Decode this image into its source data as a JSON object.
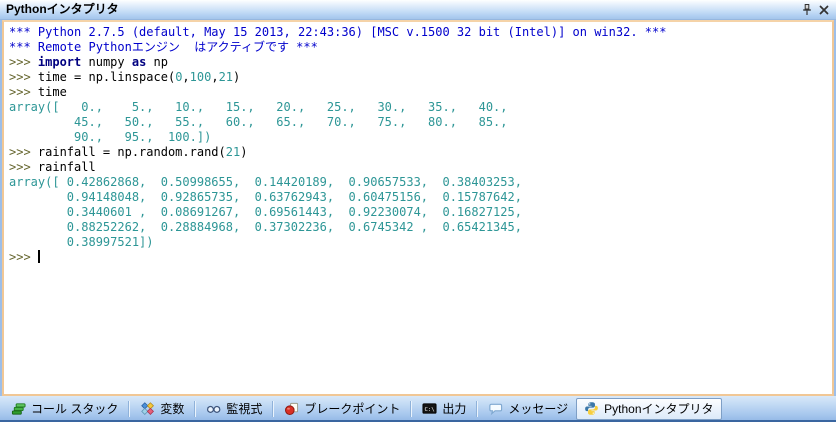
{
  "window": {
    "title": "Pythonインタプリタ"
  },
  "titlebar": {
    "icons": [
      "pin-icon",
      "close-icon"
    ]
  },
  "colors": {
    "banner_blue": "#0000CC",
    "keyword_navy": "#000080",
    "number_teal": "#2D9696",
    "prompt_olive": "#66662E",
    "panel_border_tan": "#F1C795",
    "titlebar_blue": "#AFCEF1",
    "tabbar_blue": "#A8C8EE"
  },
  "console": {
    "lines": [
      {
        "segments": [
          {
            "t": "*** Python 2.7.5 (default, May 15 2013, 22:43:36) [MSC v.1500 32 bit (Intel)] on win32. ***",
            "s": "banner"
          }
        ]
      },
      {
        "segments": [
          {
            "t": "*** Remote Pythonエンジン  はアクティブです ***",
            "s": "banner"
          }
        ]
      },
      {
        "segments": [
          {
            "t": ">>> ",
            "s": "prompt"
          },
          {
            "t": "import",
            "s": "keyword"
          },
          {
            "t": " numpy ",
            "s": "code"
          },
          {
            "t": "as",
            "s": "keyword"
          },
          {
            "t": " np",
            "s": "code"
          }
        ]
      },
      {
        "segments": [
          {
            "t": ">>> ",
            "s": "prompt"
          },
          {
            "t": "time = np.linspace(",
            "s": "code"
          },
          {
            "t": "0",
            "s": "number"
          },
          {
            "t": ",",
            "s": "code"
          },
          {
            "t": "100",
            "s": "number"
          },
          {
            "t": ",",
            "s": "code"
          },
          {
            "t": "21",
            "s": "number"
          },
          {
            "t": ")",
            "s": "code"
          }
        ]
      },
      {
        "segments": [
          {
            "t": ">>> ",
            "s": "prompt"
          },
          {
            "t": "time",
            "s": "code"
          }
        ]
      },
      {
        "segments": [
          {
            "t": "array([   0.,    5.,   10.,   15.,   20.,   25.,   30.,   35.,   40.,",
            "s": "output"
          }
        ]
      },
      {
        "segments": [
          {
            "t": "         45.,   50.,   55.,   60.,   65.,   70.,   75.,   80.,   85.,",
            "s": "output"
          }
        ]
      },
      {
        "segments": [
          {
            "t": "         90.,   95.,  100.])",
            "s": "output"
          }
        ]
      },
      {
        "segments": [
          {
            "t": ">>> ",
            "s": "prompt"
          },
          {
            "t": "rainfall = np.random.rand(",
            "s": "code"
          },
          {
            "t": "21",
            "s": "number"
          },
          {
            "t": ")",
            "s": "code"
          }
        ]
      },
      {
        "segments": [
          {
            "t": ">>> ",
            "s": "prompt"
          },
          {
            "t": "rainfall",
            "s": "code"
          }
        ]
      },
      {
        "segments": [
          {
            "t": "array([ 0.42862868,  0.50998655,  0.14420189,  0.90657533,  0.38403253,",
            "s": "output"
          }
        ]
      },
      {
        "segments": [
          {
            "t": "        0.94148048,  0.92865735,  0.63762943,  0.60475156,  0.15787642,",
            "s": "output"
          }
        ]
      },
      {
        "segments": [
          {
            "t": "        0.3440601 ,  0.08691267,  0.69561443,  0.92230074,  0.16827125,",
            "s": "output"
          }
        ]
      },
      {
        "segments": [
          {
            "t": "        0.88252262,  0.28884968,  0.37302236,  0.6745342 ,  0.65421345,",
            "s": "output"
          }
        ]
      },
      {
        "segments": [
          {
            "t": "        0.38997521])",
            "s": "output"
          }
        ]
      },
      {
        "segments": [
          {
            "t": ">>> ",
            "s": "prompt"
          },
          {
            "t": "",
            "s": "cursor"
          }
        ]
      }
    ]
  },
  "tabbar": {
    "output_icon_text": "C:\\",
    "tabs": [
      {
        "label": "コール スタック",
        "icon": "call-stack-icon",
        "active": false
      },
      {
        "label": "変数",
        "icon": "variables-icon",
        "active": false
      },
      {
        "label": "監視式",
        "icon": "watch-icon",
        "active": false
      },
      {
        "label": "ブレークポイント",
        "icon": "breakpoint-icon",
        "active": false
      },
      {
        "label": "出力",
        "icon": "output-icon",
        "active": false
      },
      {
        "label": "メッセージ",
        "icon": "messages-icon",
        "active": false
      },
      {
        "label": "Pythonインタプリタ",
        "icon": "python-icon",
        "active": true
      }
    ]
  }
}
